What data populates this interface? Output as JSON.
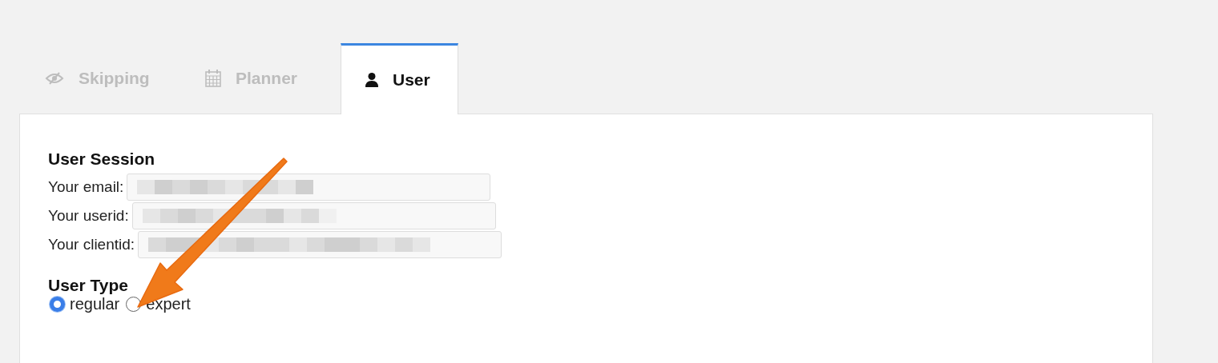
{
  "tabs": [
    {
      "label": "Skipping",
      "selected": false
    },
    {
      "label": "Planner",
      "selected": false
    },
    {
      "label": "User",
      "selected": true
    }
  ],
  "session": {
    "heading": "User Session",
    "fields": [
      {
        "label": "Your email:",
        "redacted": true
      },
      {
        "label": "Your userid:",
        "redacted": true
      },
      {
        "label": "Your clientid:",
        "redacted": true
      }
    ]
  },
  "user_type": {
    "heading": "User Type",
    "options": [
      {
        "label": "regular",
        "selected": true
      },
      {
        "label": "expert",
        "selected": false
      }
    ]
  },
  "annotation_arrow": true
}
